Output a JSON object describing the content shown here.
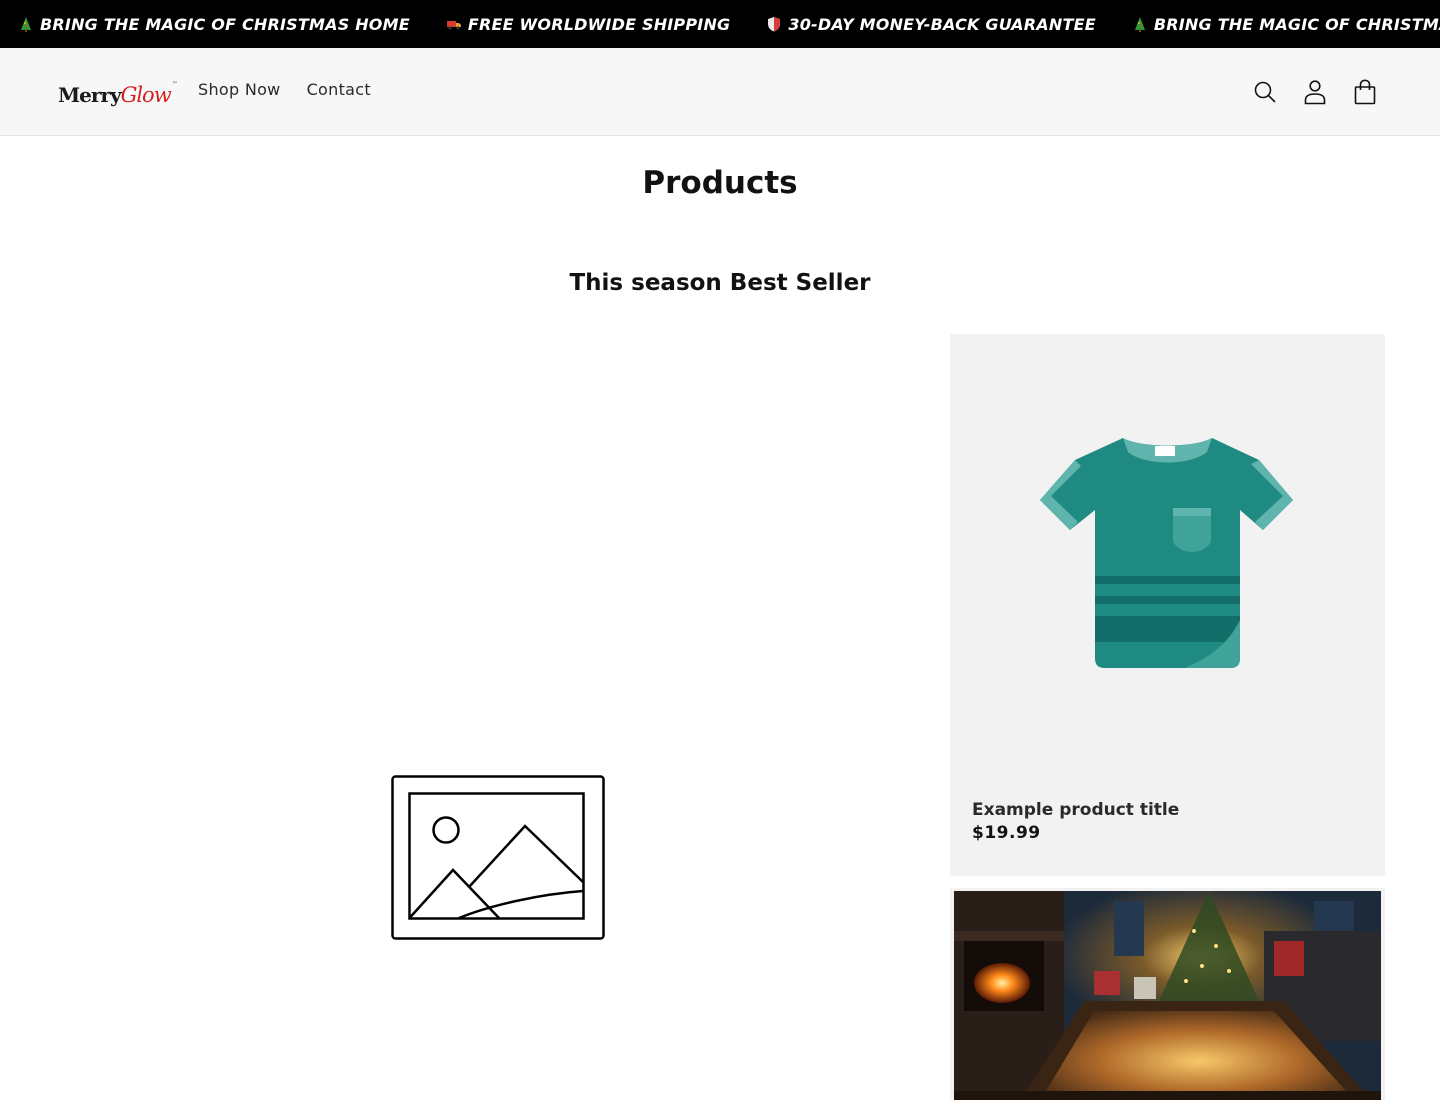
{
  "announcement": {
    "items": [
      {
        "icon": "tree-icon",
        "text": "BRING THE MAGIC OF CHRISTMAS HOME"
      },
      {
        "icon": "truck-icon",
        "text": "FREE WORLDWIDE SHIPPING"
      },
      {
        "icon": "shield-icon",
        "text": "30-DAY MONEY-BACK GUARANTEE"
      },
      {
        "icon": "tree-icon",
        "text": "BRING THE MAGIC OF CHRISTMAS HOME"
      }
    ]
  },
  "header": {
    "logo_merry": "Merry",
    "logo_glow": "Glow",
    "logo_tm": "™",
    "nav": [
      "Shop Now",
      "Contact"
    ],
    "icons": [
      "search-icon",
      "account-icon",
      "cart-icon"
    ]
  },
  "main": {
    "page_title": "Products",
    "section_title": "This season Best Seller"
  },
  "products": [
    {
      "title": "Example product title",
      "price": "$19.99",
      "image": "tshirt-image"
    },
    {
      "image": "christmas-living-room-image"
    }
  ],
  "colors": {
    "announcement_bg": "#000000",
    "header_bg": "#f7f7f7",
    "card_bg": "#f2f2f2",
    "shirt_teal": "#1f8a82",
    "logo_red": "#d32020"
  }
}
